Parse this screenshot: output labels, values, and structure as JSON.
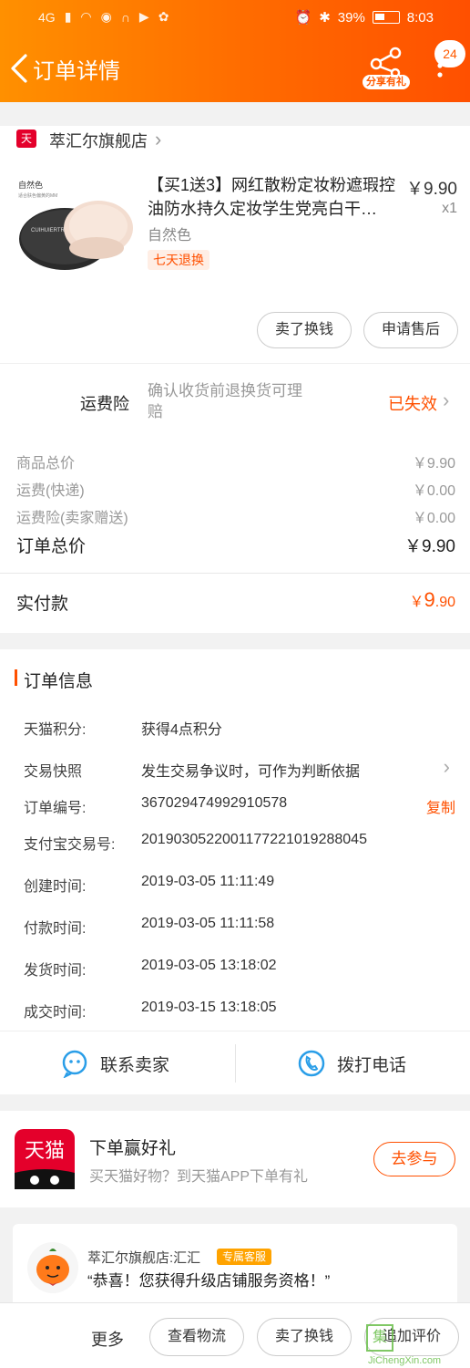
{
  "status_bar": {
    "network": "4G",
    "battery_pct": "39%",
    "time": "8:03"
  },
  "header": {
    "title": "订单详情",
    "share_label": "分享有礼",
    "badge_count": "24"
  },
  "store": {
    "logo_text": "天猫",
    "name": "萃汇尔旗舰店"
  },
  "product": {
    "title": "【买1送3】网红散粉定妆粉遮瑕控油防水持久定妆学生党亮白干…",
    "price": "￥9.90",
    "qty": "x1",
    "variant": "自然色",
    "return_tag": "七天退换",
    "image_label": "自然色",
    "image_sub": "适合肤色偏黄的MM",
    "brand": "CUIHUIERTREE"
  },
  "item_actions": {
    "sell_label": "卖了换钱",
    "aftersale_label": "申请售后"
  },
  "insurance": {
    "label": "运费险",
    "desc": "确认收货前退换货可理赔",
    "status": "已失效"
  },
  "price_lines": [
    {
      "label": "商品总价",
      "value": "￥9.90"
    },
    {
      "label": "运费(快递)",
      "value": "￥0.00"
    },
    {
      "label": "运费险(卖家赠送)",
      "value": "￥0.00"
    }
  ],
  "order_total": {
    "label": "订单总价",
    "value": "￥9.90"
  },
  "paid": {
    "label": "实付款",
    "currency": "￥",
    "int": "9",
    "dec": ".90"
  },
  "order_info": {
    "title": "订单信息",
    "rows": [
      {
        "k": "天猫积分:",
        "v": "获得4点积分"
      },
      {
        "k": "交易快照",
        "v": "发生交易争议时，可作为判断依据"
      },
      {
        "k": "订单编号:",
        "v": "367029474992910578",
        "action": "复制"
      },
      {
        "k": "支付宝交易号:",
        "v": "2019030522001177221019288045"
      },
      {
        "k": "创建时间:",
        "v": "2019-03-05 11:11:49"
      },
      {
        "k": "付款时间:",
        "v": "2019-03-05 11:11:58"
      },
      {
        "k": "发货时间:",
        "v": "2019-03-05 13:18:02"
      },
      {
        "k": "成交时间:",
        "v": "2019-03-15 13:18:05"
      }
    ]
  },
  "contact": {
    "seller_label": "联系卖家",
    "phone_label": "拨打电话"
  },
  "promo": {
    "logo_text": "天猫",
    "title": "下单赢好礼",
    "subtitle": "买天猫好物？到天猫APP下单有礼",
    "join_label": "去参与"
  },
  "chat": {
    "name": "萃汇尔旗舰店:汇汇",
    "tag": "专属客服",
    "message": "“恭喜！您获得升级店铺服务资格！”"
  },
  "bottom_bar": {
    "more_label": "更多",
    "logistics_label": "查看物流",
    "sell_label": "卖了换钱",
    "review_label": "追加评价"
  },
  "watermark": {
    "glyph": "集",
    "text": "JiChengXin.com"
  },
  "colors": {
    "accent": "#ff5000",
    "header_start": "#ff9000",
    "header_end": "#ff5000",
    "tmall_red": "#e4002b"
  }
}
